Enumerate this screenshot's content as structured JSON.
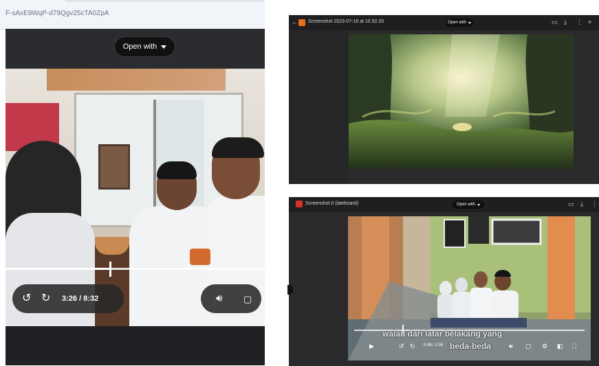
{
  "left_panel": {
    "url_text": "F-sAxE9WqP-d79Qgv25cTA0ZpA",
    "open_with_label": "Open with",
    "time_display": "3:26 / 8:32",
    "progress": 0.4
  },
  "right_top": {
    "title": "Screenshot 2023-07-18 at 10.52.33",
    "open_with_label": "Open with"
  },
  "right_bottom": {
    "title": "Screenshot 0 (lateboard)",
    "open_with_label": "Open with",
    "subtitle_line1": "walau dari latar belakang yang",
    "subtitle_line2": "beda-beda",
    "time_display": "0:48 / 1:58",
    "progress": 0.21
  },
  "colors": {
    "viewer_bg": "#202124",
    "accent_orange": "#e8711c",
    "accent_red": "#d9322a"
  },
  "icons": {
    "replay": "replay-10-icon",
    "forward": "forward-10-icon",
    "volume": "volume-icon",
    "captions": "captions-icon"
  }
}
